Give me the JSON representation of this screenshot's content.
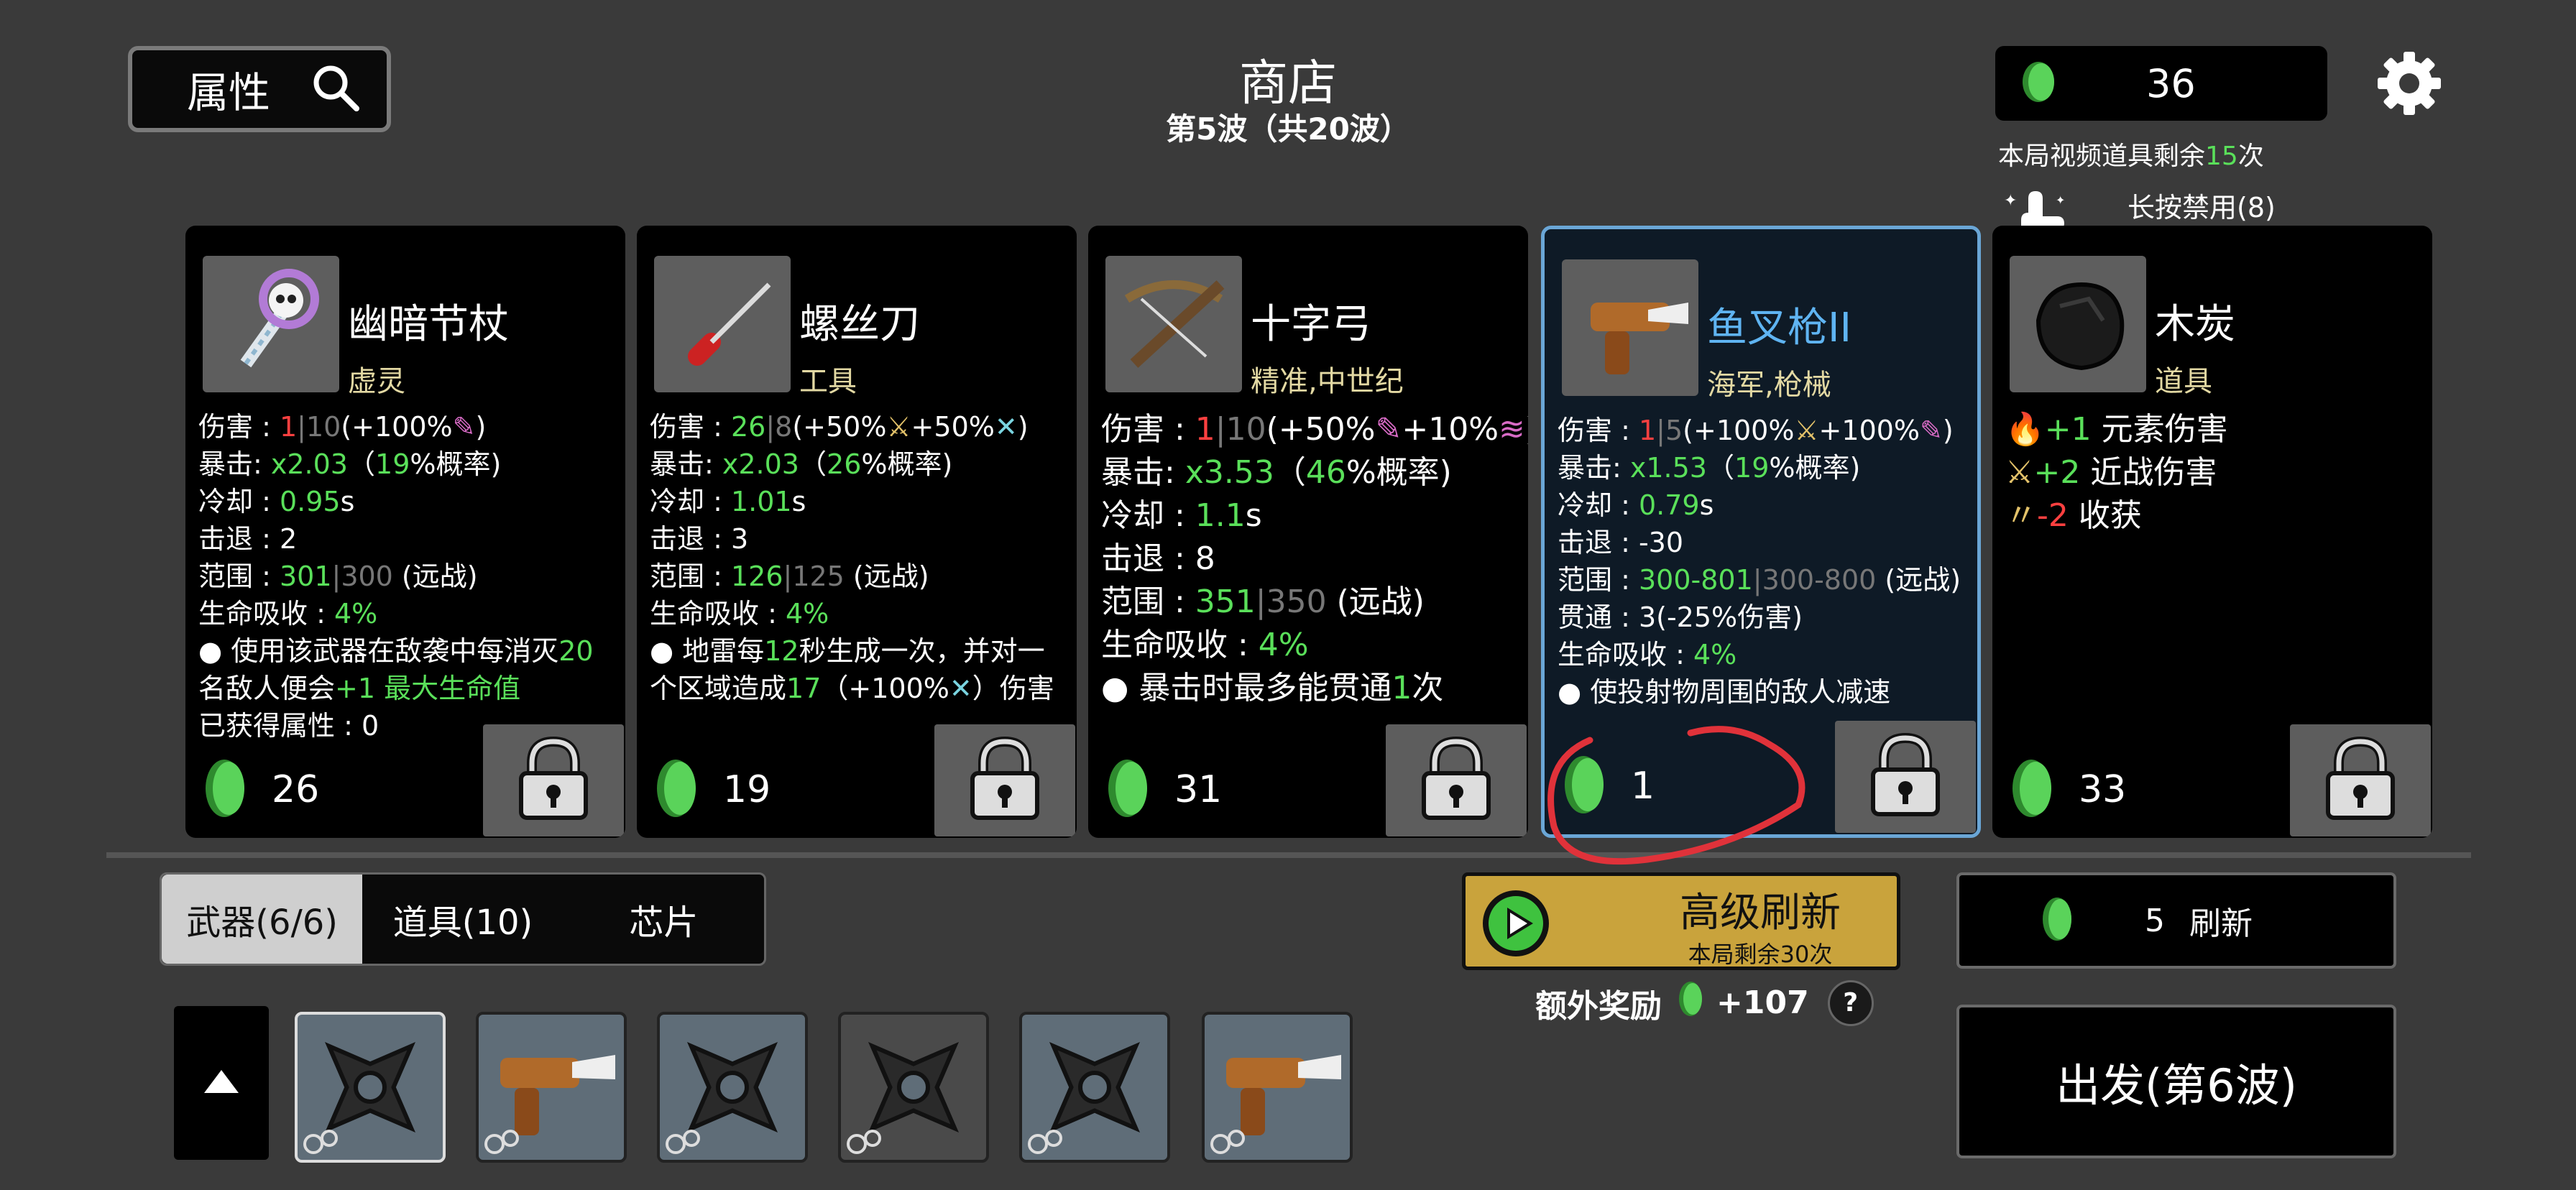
{
  "header": {
    "attributes_label": "属性",
    "title": "商店",
    "wave": "第5波（共20波）",
    "currency": "36",
    "video_left": [
      "本局视频道具剩余",
      "15",
      "次"
    ],
    "hold_disable": "长按禁用(8)"
  },
  "cards": [
    {
      "name": "幽暗节杖",
      "tags": "虚灵",
      "price": "26",
      "lines": [
        [
          [
            "伤害 : ",
            ""
          ],
          [
            "1",
            "r"
          ],
          [
            "|",
            "gr"
          ],
          [
            "10",
            "gr"
          ],
          [
            "(+100%",
            ""
          ],
          [
            "✎",
            "pk"
          ],
          [
            ")",
            ""
          ]
        ],
        [
          [
            "暴击:  ",
            ""
          ],
          [
            "x2.03",
            "g"
          ],
          [
            "（",
            ""
          ],
          [
            "19",
            "g"
          ],
          [
            "%概率)",
            ""
          ]
        ],
        [
          [
            "冷却 : ",
            ""
          ],
          [
            "0.95",
            "g"
          ],
          [
            "s",
            ""
          ]
        ],
        [
          [
            "击退 : 2",
            ""
          ]
        ],
        [
          [
            "范围 : ",
            ""
          ],
          [
            "301",
            "g"
          ],
          [
            "|",
            "gr"
          ],
          [
            "300",
            "gr"
          ],
          [
            " (远战)",
            ""
          ]
        ],
        [
          [
            "生命吸收 : ",
            ""
          ],
          [
            "4%",
            "g"
          ]
        ],
        [
          [
            " ● 使用该武器在敌袭中每消灭",
            ""
          ],
          [
            "20",
            "g"
          ]
        ],
        [
          [
            "名敌人便会",
            ""
          ],
          [
            "+1 最大生命值",
            "g"
          ]
        ],
        [
          [
            "已获得属性 :  0",
            ""
          ]
        ]
      ]
    },
    {
      "name": "螺丝刀",
      "tags": "工具",
      "price": "19",
      "lines": [
        [
          [
            "伤害 : ",
            ""
          ],
          [
            "26",
            "g"
          ],
          [
            "|",
            "gr"
          ],
          [
            "8",
            "gr"
          ],
          [
            "(+50%",
            ""
          ],
          [
            "⚔",
            "y"
          ],
          [
            "+50%",
            ""
          ],
          [
            "✕",
            "b"
          ],
          [
            ")",
            ""
          ]
        ],
        [
          [
            "暴击:  ",
            ""
          ],
          [
            "x2.03",
            "g"
          ],
          [
            "（",
            ""
          ],
          [
            "26",
            "g"
          ],
          [
            "%概率)",
            ""
          ]
        ],
        [
          [
            "冷却 : ",
            ""
          ],
          [
            "1.01",
            "g"
          ],
          [
            "s",
            ""
          ]
        ],
        [
          [
            "击退 : 3",
            ""
          ]
        ],
        [
          [
            "范围 : ",
            ""
          ],
          [
            "126",
            "g"
          ],
          [
            "|",
            "gr"
          ],
          [
            "125",
            "gr"
          ],
          [
            " (远战)",
            ""
          ]
        ],
        [
          [
            "生命吸收 : ",
            ""
          ],
          [
            "4%",
            "g"
          ]
        ],
        [
          [
            " ● 地雷每",
            ""
          ],
          [
            "12",
            "g"
          ],
          [
            "秒生成一次，并对一",
            ""
          ]
        ],
        [
          [
            "个区域造成",
            ""
          ],
          [
            "17",
            "g"
          ],
          [
            "（+100%",
            ""
          ],
          [
            "✕",
            "b"
          ],
          [
            "）伤害",
            ""
          ]
        ]
      ]
    },
    {
      "name": "十字弓",
      "tags": "精准,中世纪",
      "price": "31",
      "big": true,
      "lines": [
        [
          [
            "伤害 : ",
            ""
          ],
          [
            "1",
            "r"
          ],
          [
            "|",
            "gr"
          ],
          [
            "10",
            "gr"
          ],
          [
            "(+50%",
            ""
          ],
          [
            "✎",
            "pk"
          ],
          [
            "+10%",
            ""
          ],
          [
            "≋",
            "pk"
          ],
          [
            ")",
            ""
          ]
        ],
        [
          [
            "暴击:  ",
            ""
          ],
          [
            "x3.53",
            "g"
          ],
          [
            "（",
            ""
          ],
          [
            "46",
            "g"
          ],
          [
            "%概率)",
            ""
          ]
        ],
        [
          [
            "冷却 : ",
            ""
          ],
          [
            "1.1",
            "g"
          ],
          [
            "s",
            ""
          ]
        ],
        [
          [
            "击退 : 8",
            ""
          ]
        ],
        [
          [
            "范围 : ",
            ""
          ],
          [
            "351",
            "g"
          ],
          [
            "|",
            "gr"
          ],
          [
            "350",
            "gr"
          ],
          [
            " (远战)",
            ""
          ]
        ],
        [
          [
            "生命吸收 : ",
            ""
          ],
          [
            "4%",
            "g"
          ]
        ],
        [
          [
            " ● 暴击时最多能贯通",
            ""
          ],
          [
            "1",
            "g"
          ],
          [
            "次",
            ""
          ]
        ]
      ]
    },
    {
      "name": "鱼叉枪II",
      "tags": "海军,枪械",
      "price": "1",
      "selected": true,
      "lines": [
        [
          [
            "伤害 : ",
            ""
          ],
          [
            "1",
            "r"
          ],
          [
            "|",
            "gr"
          ],
          [
            "5",
            "gr"
          ],
          [
            "(+100%",
            ""
          ],
          [
            "⚔",
            "y"
          ],
          [
            "+100%",
            ""
          ],
          [
            "✎",
            "pk"
          ],
          [
            ")",
            ""
          ]
        ],
        [
          [
            "暴击:  ",
            ""
          ],
          [
            "x1.53",
            "g"
          ],
          [
            "（",
            ""
          ],
          [
            "19",
            "g"
          ],
          [
            "%概率)",
            ""
          ]
        ],
        [
          [
            "冷却 : ",
            ""
          ],
          [
            "0.79",
            "g"
          ],
          [
            "s",
            ""
          ]
        ],
        [
          [
            "击退 : -30",
            ""
          ]
        ],
        [
          [
            "范围 : ",
            ""
          ],
          [
            "300-801",
            "g"
          ],
          [
            "|",
            "gr"
          ],
          [
            "300-800",
            "gr"
          ],
          [
            " (远战)",
            ""
          ]
        ],
        [
          [
            "贯通 : 3(-25%伤害)",
            ""
          ]
        ],
        [
          [
            "生命吸收 : ",
            ""
          ],
          [
            "4%",
            "g"
          ]
        ],
        [
          [
            " ● 使投射物周围的敌人减速",
            ""
          ]
        ]
      ]
    },
    {
      "name": "木炭",
      "tags": "道具",
      "price": "33",
      "big": true,
      "lines": [
        [
          [
            "🔥",
            ""
          ],
          [
            "+1",
            "g"
          ],
          [
            " 元素伤害",
            ""
          ]
        ],
        [
          [
            "⚔",
            "y"
          ],
          [
            "+2",
            "g"
          ],
          [
            " 近战伤害",
            ""
          ]
        ],
        [
          [
            "〃",
            "y"
          ],
          [
            "-2",
            "r"
          ],
          [
            " 收获",
            ""
          ]
        ]
      ]
    }
  ],
  "tabs": [
    "武器(6/6)",
    "道具(10)",
    "芯片"
  ],
  "advanced_refresh": {
    "label": "高级刷新",
    "sub": "本局剩余30次"
  },
  "bonus": {
    "label": "额外奖励",
    "amount": "+107",
    "help": "?"
  },
  "refresh": {
    "cost": "5",
    "label": "刷新"
  },
  "go_button": "出发(第6波)",
  "inventory": [
    "shuriken",
    "harpoon-gun",
    "shuriken",
    "shuriken",
    "shuriken",
    "harpoon-gun"
  ],
  "colors": {
    "green": "#5ae05a",
    "red": "#ff4040",
    "gold": "#c9a33c",
    "select_border": "#6aa6d6"
  }
}
